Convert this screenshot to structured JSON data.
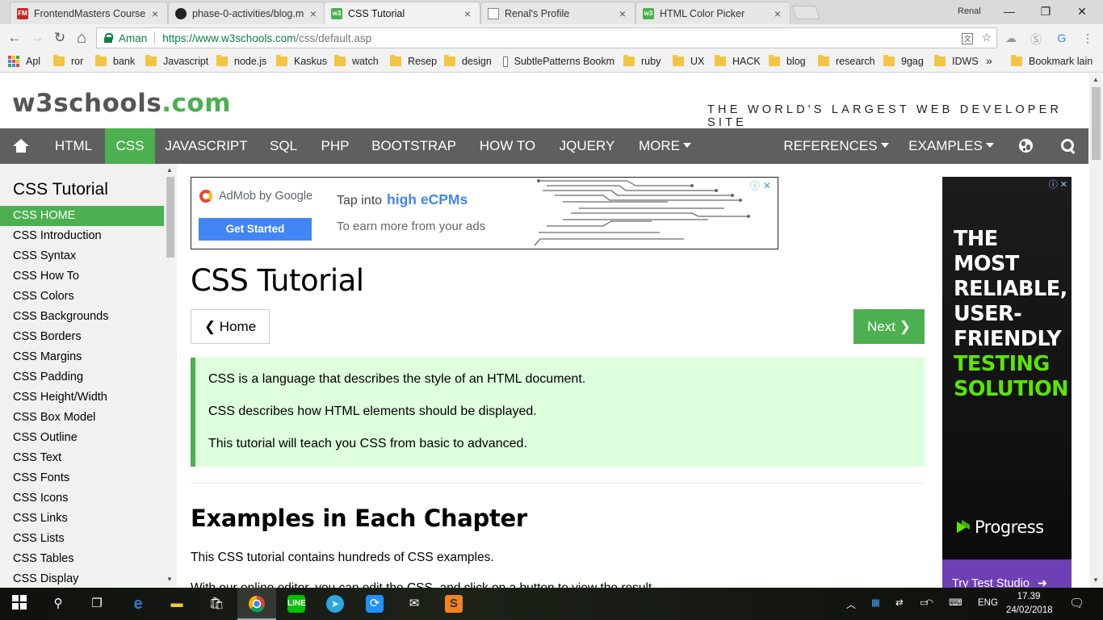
{
  "browser": {
    "tabs": [
      {
        "title": "FrontendMasters Course",
        "icon": "frontendmasters-icon",
        "color": "#c02d28"
      },
      {
        "title": "phase-0-activities/blog.m",
        "icon": "github-icon",
        "color": "#222222"
      },
      {
        "title": "CSS Tutorial",
        "icon": "w3schools-icon",
        "color": "#4caf50"
      },
      {
        "title": "Renal's Profile",
        "icon": "page-icon",
        "color": "#888888"
      },
      {
        "title": "HTML Color Picker",
        "icon": "w3schools-icon",
        "color": "#4caf50"
      }
    ],
    "tab_close": "×",
    "user": "Renal",
    "window_controls": {
      "minimize": "—",
      "maximize": "❐",
      "close": "✕"
    },
    "nav": {
      "back": "←",
      "forward": "→",
      "reload": "↻",
      "home": "⌂"
    },
    "security_label": "Aman",
    "url_scheme_host": "https://www.w3schools.com",
    "url_path": "/css/default.asp",
    "bookmarks": [
      {
        "label": "Apl",
        "type": "apps"
      },
      {
        "label": "ror",
        "type": "folder"
      },
      {
        "label": "bank",
        "type": "folder"
      },
      {
        "label": "Javascript",
        "type": "folder"
      },
      {
        "label": "node.js",
        "type": "folder"
      },
      {
        "label": "Kaskus",
        "type": "folder"
      },
      {
        "label": "watch",
        "type": "folder"
      },
      {
        "label": "Resep",
        "type": "folder"
      },
      {
        "label": "design",
        "type": "folder"
      },
      {
        "label": "SubtlePatterns Bookm",
        "type": "page"
      },
      {
        "label": "ruby",
        "type": "folder"
      },
      {
        "label": "UX",
        "type": "folder"
      },
      {
        "label": "HACK",
        "type": "folder"
      },
      {
        "label": "blog",
        "type": "folder"
      },
      {
        "label": "research",
        "type": "folder"
      },
      {
        "label": "9gag",
        "type": "folder"
      },
      {
        "label": "IDWS",
        "type": "folder"
      }
    ],
    "bookmarks_overflow": "»",
    "other_bookmarks": "Bookmark lain"
  },
  "site": {
    "logo_main": "w3schools",
    "logo_suffix": ".com",
    "tagline": "THE WORLD'S LARGEST WEB DEVELOPER SITE",
    "accent": "#4caf50",
    "nav_left": [
      {
        "label": "HTML"
      },
      {
        "label": "CSS",
        "active": true
      },
      {
        "label": "JAVASCRIPT"
      },
      {
        "label": "SQL"
      },
      {
        "label": "PHP"
      },
      {
        "label": "BOOTSTRAP"
      },
      {
        "label": "HOW TO"
      },
      {
        "label": "JQUERY"
      },
      {
        "label": "MORE"
      }
    ],
    "nav_right": [
      {
        "label": "REFERENCES"
      },
      {
        "label": "EXAMPLES"
      }
    ]
  },
  "sidebar": {
    "title": "CSS Tutorial",
    "items": [
      "CSS HOME",
      "CSS Introduction",
      "CSS Syntax",
      "CSS How To",
      "CSS Colors",
      "CSS Backgrounds",
      "CSS Borders",
      "CSS Margins",
      "CSS Padding",
      "CSS Height/Width",
      "CSS Box Model",
      "CSS Outline",
      "CSS Text",
      "CSS Fonts",
      "CSS Icons",
      "CSS Links",
      "CSS Lists",
      "CSS Tables",
      "CSS Display"
    ],
    "active_index": 0
  },
  "ad_top": {
    "brand": "AdMob by Google",
    "cta": "Get Started",
    "line1_prefix": "Tap into",
    "line1_highlight": "high eCPMs",
    "line2": "To earn more from your ads"
  },
  "main": {
    "title": "CSS Tutorial",
    "prev_label": "Home",
    "next_label": "Next",
    "intro": [
      "CSS is a language that describes the style of an HTML document.",
      "CSS describes how HTML elements should be displayed.",
      "This tutorial will teach you CSS from basic to advanced."
    ],
    "section_title": "Examples in Each Chapter",
    "section_text": "This CSS tutorial contains hundreds of CSS examples.",
    "section_text2": "With our online editor, you can edit the CSS, and click on a button to view the result."
  },
  "ad_right": {
    "headline": [
      "THE",
      "MOST",
      "RELIABLE,",
      "USER-",
      "FRIENDLY"
    ],
    "headline_green": [
      "TESTING",
      "SOLUTION"
    ],
    "brand": "Progress",
    "cta": "Try Test Studio"
  },
  "taskbar": {
    "language": "ENG",
    "time": "17.39",
    "date": "24/02/2018"
  }
}
